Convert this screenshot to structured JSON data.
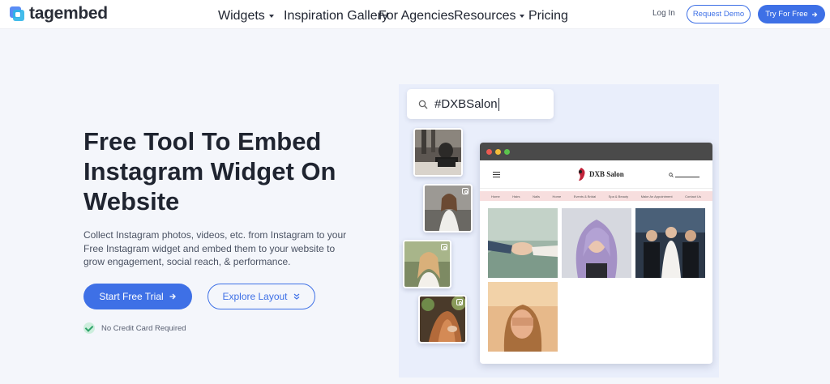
{
  "brand": {
    "name": "tagembed",
    "accent": "#3e70e6"
  },
  "nav": {
    "items": [
      {
        "label": "Widgets",
        "dropdown": true
      },
      {
        "label": "Inspiration Gallery",
        "dropdown": false
      },
      {
        "label": "For Agencies",
        "dropdown": false
      },
      {
        "label": "Resources",
        "dropdown": true
      },
      {
        "label": "Pricing",
        "dropdown": false
      }
    ],
    "login": "Log In",
    "request_demo": "Request Demo",
    "try_free": "Try For Free"
  },
  "hero": {
    "title": "Free Tool To Embed Instagram Widget On Website",
    "description": "Collect Instagram photos, videos, etc. from Instagram to your Free Instagram widget and embed them to your website to grow engagement, social reach, & performance.",
    "start_trial": "Start Free Trial",
    "explore_layout": "Explore Layout",
    "no_card": "No Credit Card Required"
  },
  "illustration": {
    "search_query": "#DXBSalon",
    "site_name": "DXB Salon",
    "site_menu": [
      "Home",
      "Hairs",
      "Nails",
      "Home",
      "Events & Bridal",
      "Spa & Beauty",
      "Make An Appointment",
      "Contact Us"
    ]
  }
}
